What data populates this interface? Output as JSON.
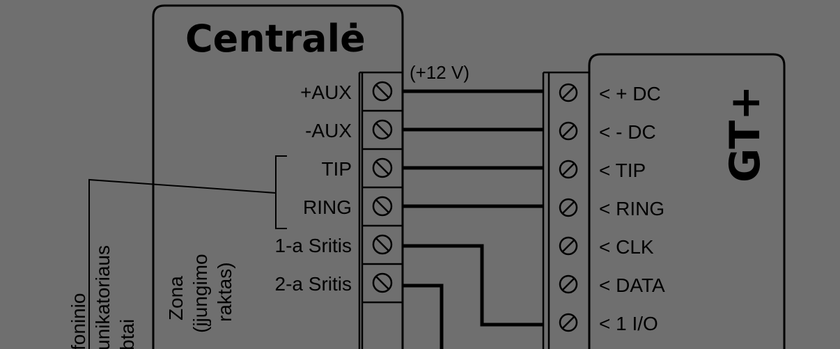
{
  "panel_title": "Centralė",
  "device_title": "GT+",
  "voltage_label": "(+12 V)",
  "panel_terminals": [
    "+AUX",
    "-AUX",
    "TIP",
    "RING",
    "1-a Sritis",
    "2-a Sritis"
  ],
  "device_terminals": [
    "< + DC",
    "< - DC",
    "< TIP",
    "< RING",
    "< CLK",
    "< DATA",
    "< 1 I/O"
  ],
  "zone_label": [
    "Zona",
    "(įjungimo",
    "raktas)"
  ],
  "side_label": [
    "foninio",
    "unikatoriaus",
    "btai"
  ]
}
